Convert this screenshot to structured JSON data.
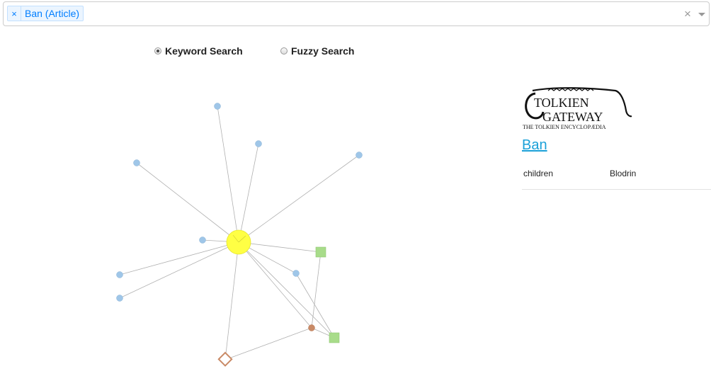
{
  "search": {
    "selected_tag": "Ban (Article)",
    "tag_remove": "×",
    "clear": "×"
  },
  "search_modes": {
    "keyword": "Keyword Search",
    "fuzzy": "Fuzzy Search",
    "selected": "keyword"
  },
  "logo": {
    "line1": "TOLKIEN",
    "line2": "GATEWAY",
    "tagline": "THE TOLKIEN ENCYCLOPÆDIA"
  },
  "article": {
    "title": "Ban",
    "properties": [
      {
        "key": "children",
        "value": "Blodrin"
      }
    ]
  },
  "colors": {
    "center_node": "#ffff44",
    "article_node": "#9fc6e8",
    "square_node": "#a8dc8a",
    "brown_node": "#c98a66",
    "link": "#b0b0b0",
    "accent": "#007eff",
    "title_link": "#1aa0d8"
  }
}
